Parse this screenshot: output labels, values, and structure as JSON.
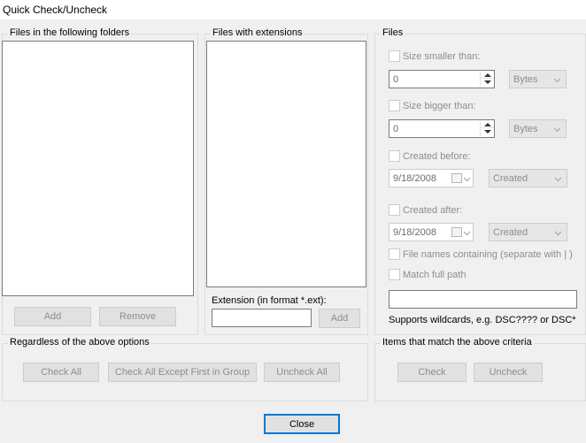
{
  "window": {
    "title": "Quick Check/Uncheck"
  },
  "folders": {
    "label": "Files in the following folders",
    "add_label": "Add",
    "remove_label": "Remove"
  },
  "extensions": {
    "label": "Files with extensions",
    "extension_label": "Extension (in format *.ext):",
    "extension_value": "",
    "add_label": "Add"
  },
  "files": {
    "label": "Files",
    "size_smaller": {
      "label": "Size smaller than:",
      "value": "0",
      "unit": "Bytes"
    },
    "size_bigger": {
      "label": "Size bigger than:",
      "value": "0",
      "unit": "Bytes"
    },
    "created_before": {
      "label": "Created before:",
      "date": "9/18/2008",
      "type": "Created"
    },
    "created_after": {
      "label": "Created after:",
      "date": "9/18/2008",
      "type": "Created"
    },
    "names_containing": {
      "label": "File names containing (separate with | )"
    },
    "match_full_path": {
      "label": "Match full path"
    },
    "pattern_value": "",
    "wildcard_note": "Supports wildcards, e.g. DSC???? or DSC*"
  },
  "regardless": {
    "label": "Regardless of the above options",
    "check_all": "Check All",
    "check_all_except": "Check All Except First in Group",
    "uncheck_all": "Uncheck All"
  },
  "matching": {
    "label": "Items that match the above criteria",
    "check": "Check",
    "uncheck": "Uncheck"
  },
  "footer": {
    "close": "Close"
  }
}
